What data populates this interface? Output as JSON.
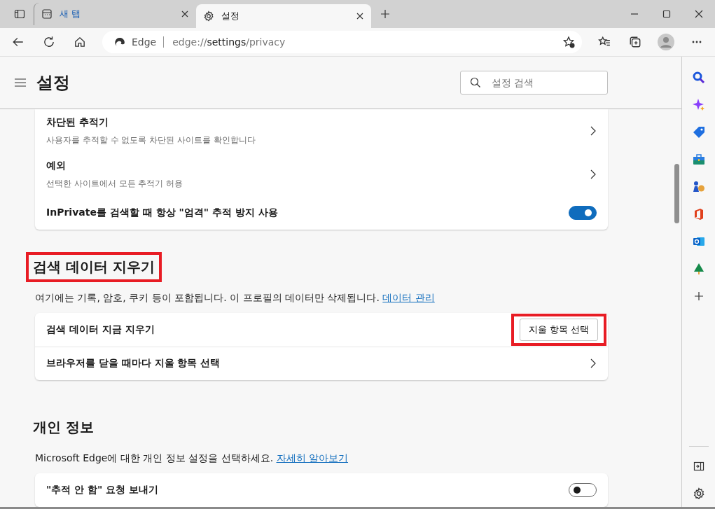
{
  "tabs": [
    {
      "label": "새 탭",
      "kind": "newtab",
      "selected": false
    },
    {
      "label": "설정",
      "kind": "settings",
      "selected": true
    }
  ],
  "address": {
    "site": "Edge",
    "url_prefix": "edge://",
    "url_host": "settings",
    "url_path": "/privacy"
  },
  "page_title": "설정",
  "search": {
    "placeholder": "설정 검색"
  },
  "top_card": {
    "rows": [
      {
        "kind": "nav",
        "title": "차단된 추적기",
        "subtitle": "사용자를 추적할 수 없도록 차단된 사이트를 확인합니다"
      },
      {
        "kind": "nav",
        "title": "예외",
        "subtitle": "선택한 사이트에서 모든 추적기 허용"
      },
      {
        "kind": "toggle",
        "title": "InPrivate를 검색할 때 항상 \"엄격\" 추적 방지 사용",
        "on": true
      }
    ]
  },
  "sections": [
    {
      "title": "검색 데이터 지우기",
      "highlighted": true,
      "description": "여기에는 기록, 암호, 쿠키 등이 포함됩니다. 이 프로필의 데이터만 삭제됩니다.",
      "link": "데이터 관리",
      "rows": [
        {
          "kind": "button",
          "title": "검색 데이터 지금 지우기",
          "button": "지울 항목 선택",
          "highlighted": true
        },
        {
          "kind": "nav",
          "title": "브라우저를 닫을 때마다 지울 항목 선택"
        }
      ]
    },
    {
      "title": "개인 정보",
      "highlighted": false,
      "description": "Microsoft Edge에 대한 개인 정보 설정을 선택하세요.",
      "link": "자세히 알아보기",
      "rows": [
        {
          "kind": "toggle",
          "title": "\"추적 안 함\" 요청 보내기",
          "on": false
        }
      ]
    }
  ]
}
